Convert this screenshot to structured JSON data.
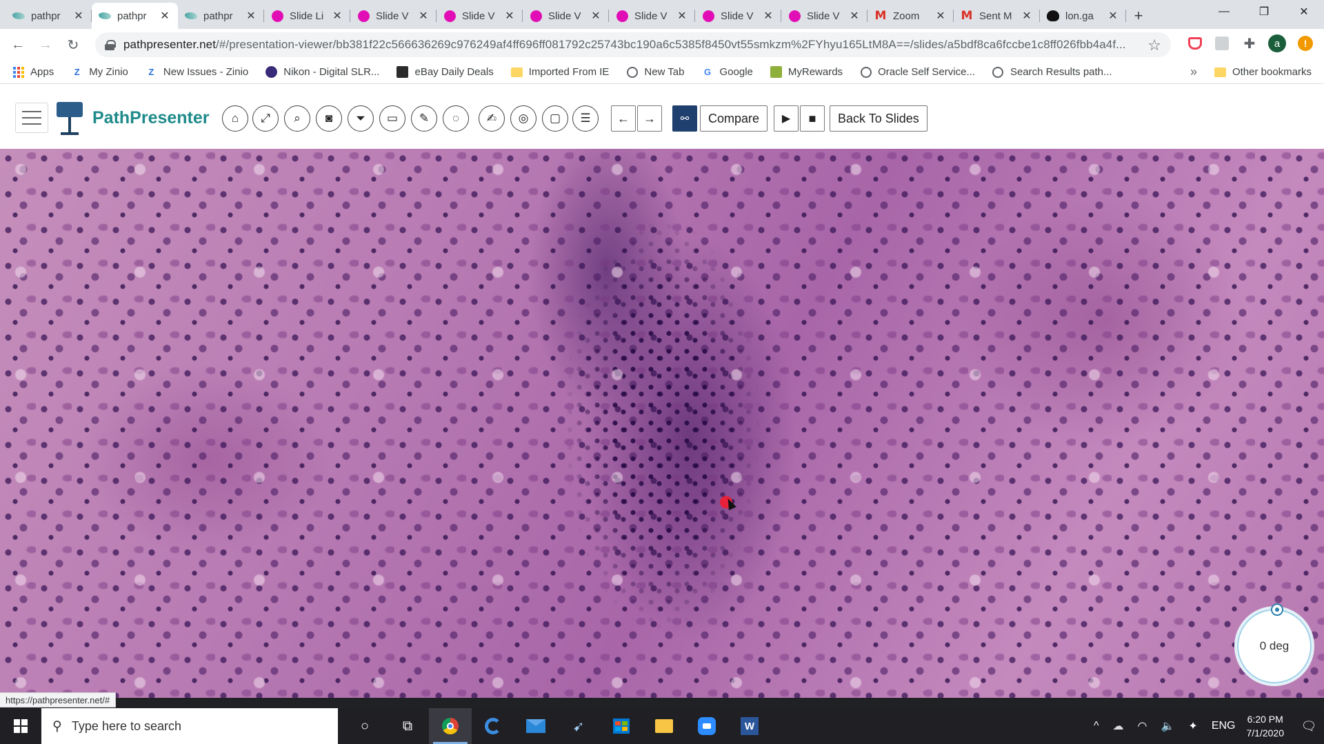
{
  "browser": {
    "tabs": [
      {
        "favicon": "pathpresenter",
        "title": "pathpr",
        "active": false
      },
      {
        "favicon": "pathpresenter",
        "title": "pathpr",
        "active": true
      },
      {
        "favicon": "pathpresenter",
        "title": "pathpr",
        "active": false
      },
      {
        "favicon": "slide",
        "title": "Slide Li",
        "active": false
      },
      {
        "favicon": "slide",
        "title": "Slide V",
        "active": false
      },
      {
        "favicon": "slide",
        "title": "Slide V",
        "active": false
      },
      {
        "favicon": "slide",
        "title": "Slide V",
        "active": false
      },
      {
        "favicon": "slide",
        "title": "Slide V",
        "active": false
      },
      {
        "favicon": "slide",
        "title": "Slide V",
        "active": false
      },
      {
        "favicon": "slide",
        "title": "Slide V",
        "active": false
      },
      {
        "favicon": "gmail",
        "title": "Zoom",
        "active": false
      },
      {
        "favicon": "gmail",
        "title": "Sent M",
        "active": false
      },
      {
        "favicon": "zoom",
        "title": "lon.ga",
        "active": false
      }
    ],
    "close_glyph": "✕",
    "new_tab_glyph": "+",
    "window_controls": {
      "minimize": "—",
      "restore": "❐",
      "close": "✕"
    },
    "url_host": "pathpresenter.net",
    "url_path": "/#/presentation-viewer/bb381f22c566636269c976249af4ff696ff081792c25743bc190a6c5385f8450vt55smkzm%2FYhyu165LtM8A==/slides/a5bdf8ca6fccbe1c8ff026fbb4a4f...",
    "profile_initial": "a",
    "update_badge": "!"
  },
  "bookmarks": {
    "items": [
      {
        "icon": "apps-grid-icon",
        "label": "Apps"
      },
      {
        "icon": "zinio-icon",
        "label": "My Zinio"
      },
      {
        "icon": "zinio-icon",
        "label": "New Issues - Zinio"
      },
      {
        "icon": "nikon-icon",
        "label": "Nikon - Digital SLR..."
      },
      {
        "icon": "ebay-icon",
        "label": "eBay Daily Deals"
      },
      {
        "icon": "folder-icon",
        "label": "Imported From IE"
      },
      {
        "icon": "globe-icon",
        "label": "New Tab"
      },
      {
        "icon": "google-icon",
        "label": "Google"
      },
      {
        "icon": "myrewards-icon",
        "label": "MyRewards"
      },
      {
        "icon": "globe-icon",
        "label": "Oracle Self Service..."
      },
      {
        "icon": "globe-icon",
        "label": "Search Results path..."
      }
    ],
    "more_glyph": "»",
    "other_label": "Other bookmarks"
  },
  "app": {
    "brand": "PathPresenter",
    "tools": [
      {
        "name": "home-icon",
        "glyph": "⌂"
      },
      {
        "name": "fullscreen-icon",
        "glyph": "⤢"
      },
      {
        "name": "zoom-icon",
        "glyph": "⌕"
      },
      {
        "name": "camera-icon",
        "glyph": "◙"
      },
      {
        "name": "filter-icon",
        "glyph": "⏷"
      },
      {
        "name": "presentation-icon",
        "glyph": "▭"
      },
      {
        "name": "pencil-icon",
        "glyph": "✎"
      },
      {
        "name": "lasso-icon",
        "glyph": "◌"
      },
      {
        "name": "annotate-icon",
        "glyph": "✍"
      },
      {
        "name": "target-icon",
        "glyph": "◎"
      },
      {
        "name": "square-icon",
        "glyph": "▢"
      },
      {
        "name": "list-icon",
        "glyph": "☰"
      }
    ],
    "prev_glyph": "←",
    "next_glyph": "→",
    "link_glyph": "🔗",
    "compare_label": "Compare",
    "video_glyph": "■",
    "stop_glyph": "■",
    "back_label": "Back To Slides"
  },
  "viewer": {
    "rotation_label": "0 deg",
    "status_url": "https://pathpresenter.net/#"
  },
  "taskbar": {
    "search_placeholder": "Type here to search",
    "search_glyph": "⚲",
    "cortana_glyph": "○",
    "taskview_glyph": "⧉",
    "language": "ENG",
    "time": "6:20 PM",
    "date": "7/1/2020",
    "tray_glyphs": {
      "chevron": "^",
      "network": "⌂",
      "volume": "🔈",
      "dropbox": "✦"
    },
    "notification_glyph": "🗨"
  }
}
